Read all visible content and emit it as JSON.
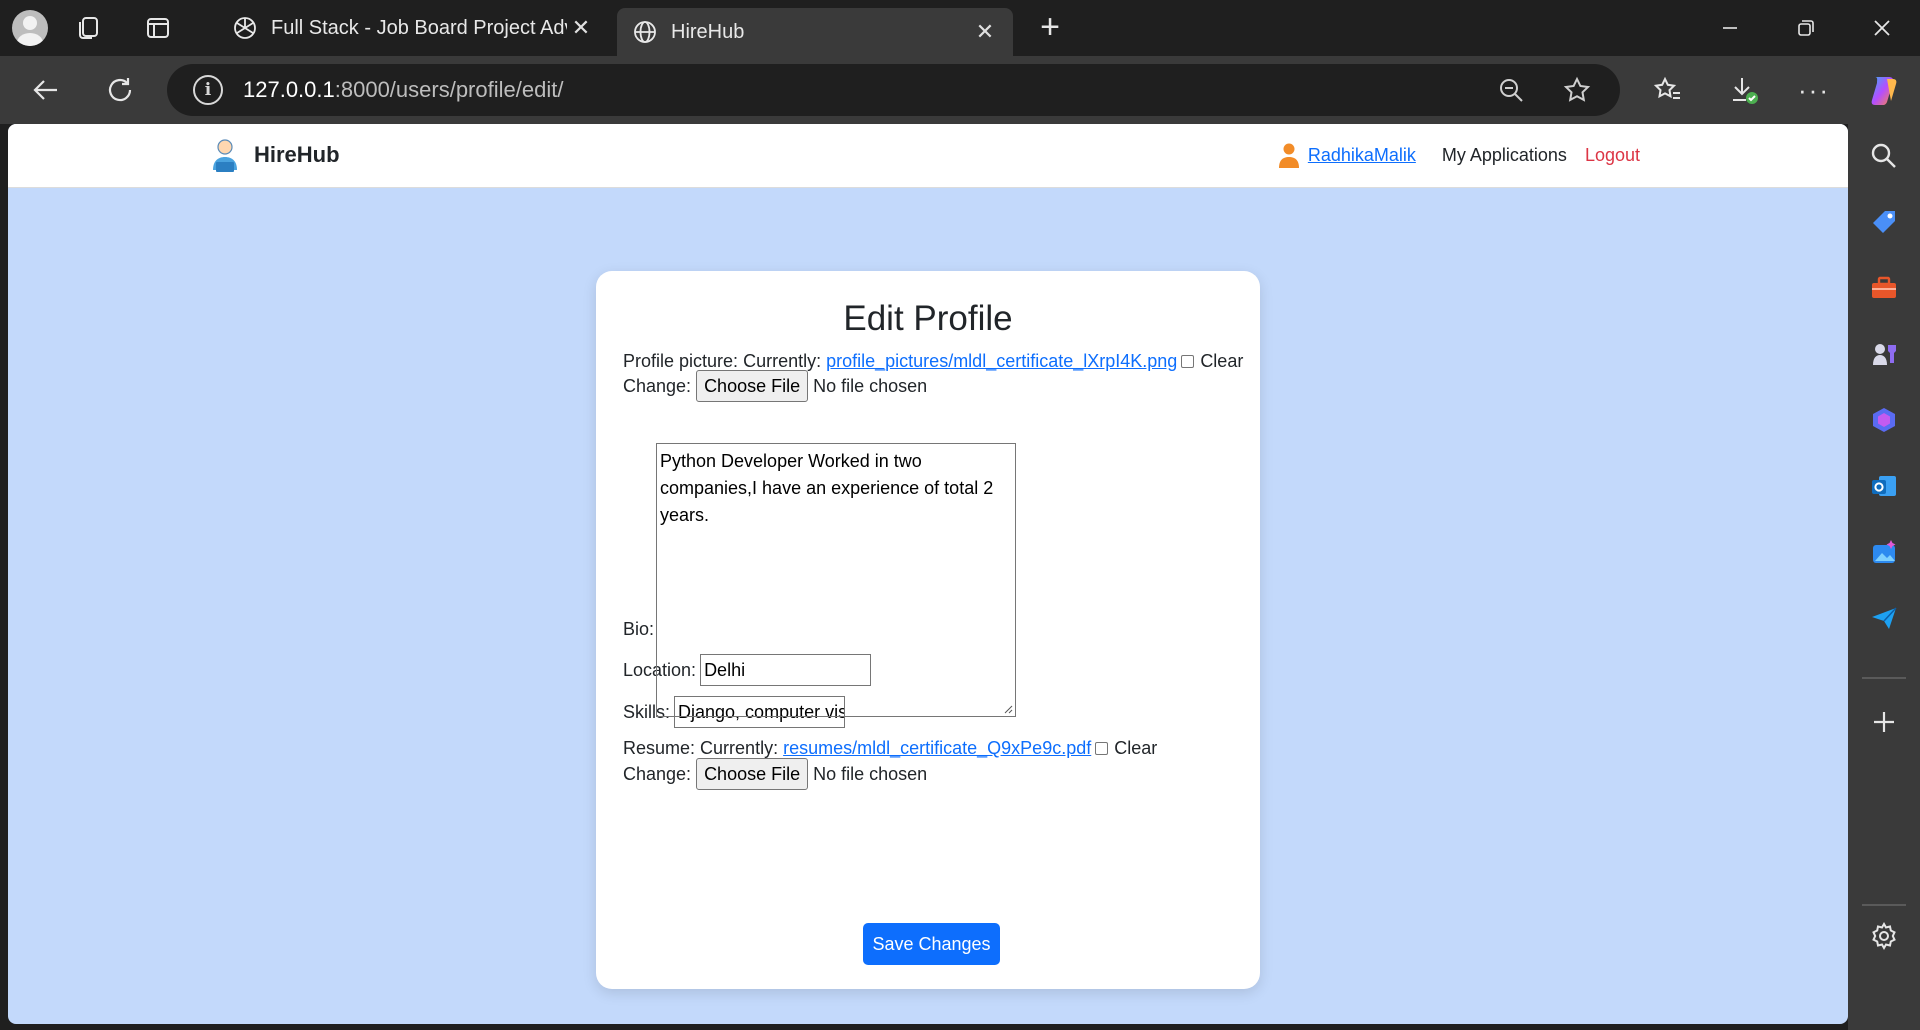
{
  "browser": {
    "tabs": [
      {
        "title": "Full Stack - Job Board Project Adv",
        "active": false
      },
      {
        "title": "HireHub",
        "active": true
      }
    ],
    "url_host": "127.0.0.1",
    "url_rest": ":8000/users/profile/edit/"
  },
  "site": {
    "brand": "HireHub",
    "nav": {
      "username": "RadhikaMalik",
      "applications": "My Applications",
      "logout": "Logout"
    }
  },
  "form": {
    "title": "Edit Profile",
    "profile_picture": {
      "label": "Profile picture:",
      "currently_label": "Currently:",
      "current_file": "profile_pictures/mldl_certificate_lXrpI4K.png",
      "clear_label": "Clear",
      "change_label": "Change:",
      "choose_label": "Choose File",
      "no_file": "No file chosen"
    },
    "bio": {
      "label": "Bio:",
      "value": "Python Developer Worked in two companies,I have an experience of total 2 years."
    },
    "location": {
      "label": "Location:",
      "value": "Delhi"
    },
    "skills": {
      "label": "Skills:",
      "value": "Django, computer vision,"
    },
    "resume": {
      "label": "Resume:",
      "currently_label": "Currently:",
      "current_file": "resumes/mldl_certificate_Q9xPe9c.pdf",
      "clear_label": "Clear",
      "change_label": "Change:",
      "choose_label": "Choose File",
      "no_file": "No file chosen"
    },
    "submit_label": "Save Changes"
  },
  "colors": {
    "page_bg": "#c3d9fb",
    "primary": "#0d6efd",
    "danger": "#dc3545"
  }
}
